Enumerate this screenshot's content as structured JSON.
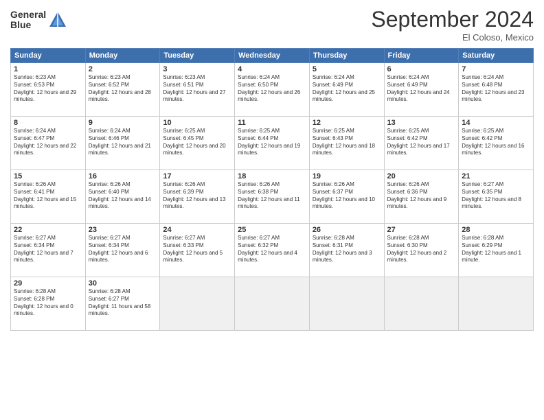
{
  "logo": {
    "line1": "General",
    "line2": "Blue"
  },
  "title": "September 2024",
  "location": "El Coloso, Mexico",
  "days_header": [
    "Sunday",
    "Monday",
    "Tuesday",
    "Wednesday",
    "Thursday",
    "Friday",
    "Saturday"
  ],
  "weeks": [
    [
      {
        "num": "1",
        "sunrise": "6:23 AM",
        "sunset": "6:53 PM",
        "daylight": "12 hours and 29 minutes."
      },
      {
        "num": "2",
        "sunrise": "6:23 AM",
        "sunset": "6:52 PM",
        "daylight": "12 hours and 28 minutes."
      },
      {
        "num": "3",
        "sunrise": "6:23 AM",
        "sunset": "6:51 PM",
        "daylight": "12 hours and 27 minutes."
      },
      {
        "num": "4",
        "sunrise": "6:24 AM",
        "sunset": "6:50 PM",
        "daylight": "12 hours and 26 minutes."
      },
      {
        "num": "5",
        "sunrise": "6:24 AM",
        "sunset": "6:49 PM",
        "daylight": "12 hours and 25 minutes."
      },
      {
        "num": "6",
        "sunrise": "6:24 AM",
        "sunset": "6:49 PM",
        "daylight": "12 hours and 24 minutes."
      },
      {
        "num": "7",
        "sunrise": "6:24 AM",
        "sunset": "6:48 PM",
        "daylight": "12 hours and 23 minutes."
      }
    ],
    [
      {
        "num": "8",
        "sunrise": "6:24 AM",
        "sunset": "6:47 PM",
        "daylight": "12 hours and 22 minutes."
      },
      {
        "num": "9",
        "sunrise": "6:24 AM",
        "sunset": "6:46 PM",
        "daylight": "12 hours and 21 minutes."
      },
      {
        "num": "10",
        "sunrise": "6:25 AM",
        "sunset": "6:45 PM",
        "daylight": "12 hours and 20 minutes."
      },
      {
        "num": "11",
        "sunrise": "6:25 AM",
        "sunset": "6:44 PM",
        "daylight": "12 hours and 19 minutes."
      },
      {
        "num": "12",
        "sunrise": "6:25 AM",
        "sunset": "6:43 PM",
        "daylight": "12 hours and 18 minutes."
      },
      {
        "num": "13",
        "sunrise": "6:25 AM",
        "sunset": "6:42 PM",
        "daylight": "12 hours and 17 minutes."
      },
      {
        "num": "14",
        "sunrise": "6:25 AM",
        "sunset": "6:42 PM",
        "daylight": "12 hours and 16 minutes."
      }
    ],
    [
      {
        "num": "15",
        "sunrise": "6:26 AM",
        "sunset": "6:41 PM",
        "daylight": "12 hours and 15 minutes."
      },
      {
        "num": "16",
        "sunrise": "6:26 AM",
        "sunset": "6:40 PM",
        "daylight": "12 hours and 14 minutes."
      },
      {
        "num": "17",
        "sunrise": "6:26 AM",
        "sunset": "6:39 PM",
        "daylight": "12 hours and 13 minutes."
      },
      {
        "num": "18",
        "sunrise": "6:26 AM",
        "sunset": "6:38 PM",
        "daylight": "12 hours and 11 minutes."
      },
      {
        "num": "19",
        "sunrise": "6:26 AM",
        "sunset": "6:37 PM",
        "daylight": "12 hours and 10 minutes."
      },
      {
        "num": "20",
        "sunrise": "6:26 AM",
        "sunset": "6:36 PM",
        "daylight": "12 hours and 9 minutes."
      },
      {
        "num": "21",
        "sunrise": "6:27 AM",
        "sunset": "6:35 PM",
        "daylight": "12 hours and 8 minutes."
      }
    ],
    [
      {
        "num": "22",
        "sunrise": "6:27 AM",
        "sunset": "6:34 PM",
        "daylight": "12 hours and 7 minutes."
      },
      {
        "num": "23",
        "sunrise": "6:27 AM",
        "sunset": "6:34 PM",
        "daylight": "12 hours and 6 minutes."
      },
      {
        "num": "24",
        "sunrise": "6:27 AM",
        "sunset": "6:33 PM",
        "daylight": "12 hours and 5 minutes."
      },
      {
        "num": "25",
        "sunrise": "6:27 AM",
        "sunset": "6:32 PM",
        "daylight": "12 hours and 4 minutes."
      },
      {
        "num": "26",
        "sunrise": "6:28 AM",
        "sunset": "6:31 PM",
        "daylight": "12 hours and 3 minutes."
      },
      {
        "num": "27",
        "sunrise": "6:28 AM",
        "sunset": "6:30 PM",
        "daylight": "12 hours and 2 minutes."
      },
      {
        "num": "28",
        "sunrise": "6:28 AM",
        "sunset": "6:29 PM",
        "daylight": "12 hours and 1 minute."
      }
    ],
    [
      {
        "num": "29",
        "sunrise": "6:28 AM",
        "sunset": "6:28 PM",
        "daylight": "12 hours and 0 minutes."
      },
      {
        "num": "30",
        "sunrise": "6:28 AM",
        "sunset": "6:27 PM",
        "daylight": "11 hours and 58 minutes."
      },
      null,
      null,
      null,
      null,
      null
    ]
  ]
}
